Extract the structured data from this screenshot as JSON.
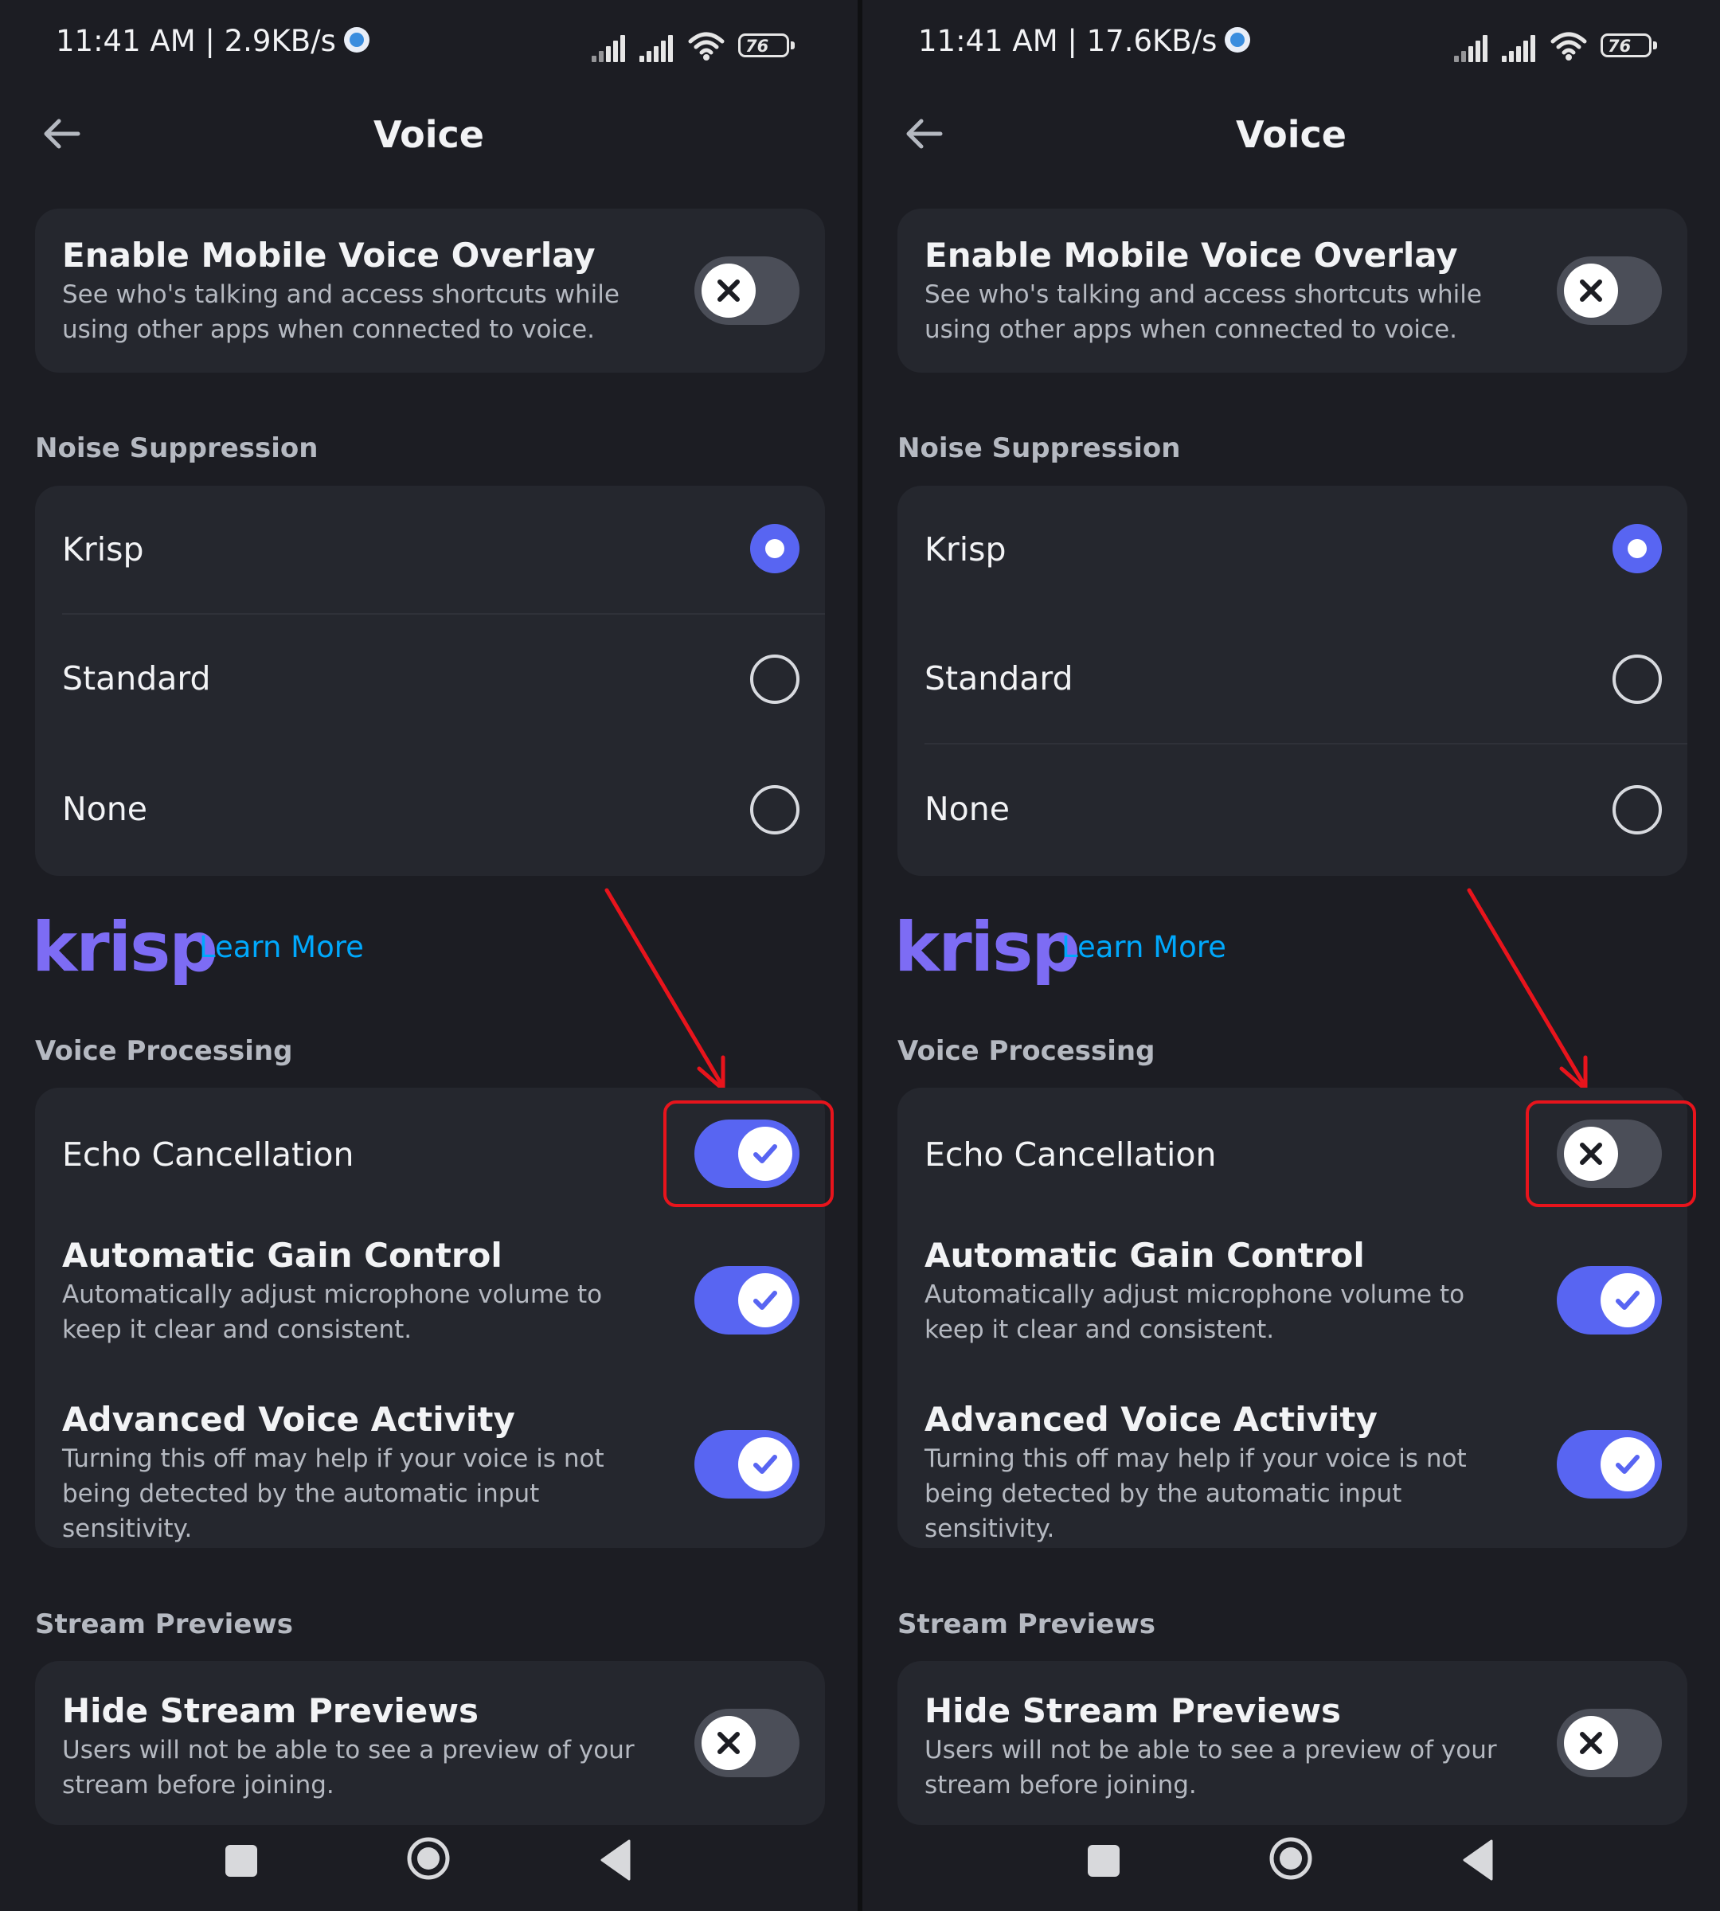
{
  "panels": [
    {
      "status_bar": {
        "time_speed": "11:41 AM | 2.9KB/s",
        "battery": "76"
      },
      "title": "Voice",
      "overlay": {
        "title": "Enable Mobile Voice Overlay",
        "desc": "See who's talking and access shortcuts while using other apps when connected to voice.",
        "enabled": false
      },
      "noise_suppression": {
        "header": "Noise Suppression",
        "options": [
          "Krisp",
          "Standard",
          "None"
        ],
        "selected": "Krisp"
      },
      "krisp": {
        "logo": "krisp",
        "learn_more": "Learn More"
      },
      "voice_processing": {
        "header": "Voice Processing",
        "echo": {
          "title": "Echo Cancellation",
          "enabled": true
        },
        "agc": {
          "title": "Automatic Gain Control",
          "desc": "Automatically adjust microphone volume to keep it clear and consistent.",
          "enabled": true
        },
        "ava": {
          "title": "Advanced Voice Activity",
          "desc": "Turning this off may help if your voice is not being detected by the automatic input sensitivity.",
          "enabled": true
        }
      },
      "stream_previews": {
        "header": "Stream Previews",
        "hide": {
          "title": "Hide Stream Previews",
          "desc": "Users will not be able to see a preview of your stream before joining.",
          "enabled": false
        }
      }
    },
    {
      "status_bar": {
        "time_speed": "11:41 AM | 17.6KB/s",
        "battery": "76"
      },
      "title": "Voice",
      "overlay": {
        "title": "Enable Mobile Voice Overlay",
        "desc": "See who's talking and access shortcuts while using other apps when connected to voice.",
        "enabled": false
      },
      "noise_suppression": {
        "header": "Noise Suppression",
        "options": [
          "Krisp",
          "Standard",
          "None"
        ],
        "selected": "Krisp"
      },
      "krisp": {
        "logo": "krisp",
        "learn_more": "Learn More"
      },
      "voice_processing": {
        "header": "Voice Processing",
        "echo": {
          "title": "Echo Cancellation",
          "enabled": false
        },
        "agc": {
          "title": "Automatic Gain Control",
          "desc": "Automatically adjust microphone volume to keep it clear and consistent.",
          "enabled": true
        },
        "ava": {
          "title": "Advanced Voice Activity",
          "desc": "Turning this off may help if your voice is not being detected by the automatic input sensitivity.",
          "enabled": true
        }
      },
      "stream_previews": {
        "header": "Stream Previews",
        "hide": {
          "title": "Hide Stream Previews",
          "desc": "Users will not be able to see a preview of your stream before joining.",
          "enabled": false
        }
      }
    }
  ],
  "colors": {
    "accent": "#5865f2",
    "link": "#00a8fc",
    "krisp": "#7d6cf4",
    "highlight": "#e8141c"
  }
}
